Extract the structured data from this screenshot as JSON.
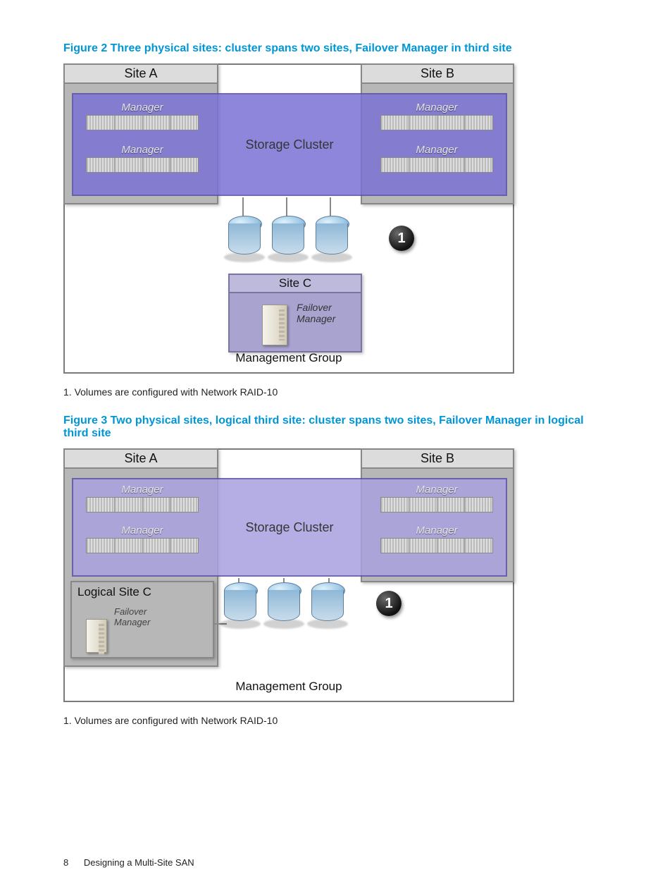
{
  "figure2": {
    "caption": "Figure 2 Three physical sites: cluster spans two sites, Failover Manager in third site",
    "siteA": "Site A",
    "siteB": "Site B",
    "siteC": "Site C",
    "cluster": "Storage Cluster",
    "manager": "Manager",
    "failover": "Failover\nManager",
    "mgmt": "Management Group",
    "badge": "1",
    "note": "1. Volumes are configured with Network RAID-10"
  },
  "figure3": {
    "caption": "Figure 3 Two physical sites, logical third site: cluster spans two sites, Failover Manager in logical third site",
    "siteA": "Site A",
    "siteB": "Site B",
    "logicalC": "Logical Site C",
    "cluster": "Storage Cluster",
    "manager": "Manager",
    "failover": "Failover\nManager",
    "mgmt": "Management Group",
    "badge": "1",
    "note": "1. Volumes are configured with Network RAID-10"
  },
  "footer": {
    "page": "8",
    "chapter": "Designing a Multi-Site SAN"
  }
}
